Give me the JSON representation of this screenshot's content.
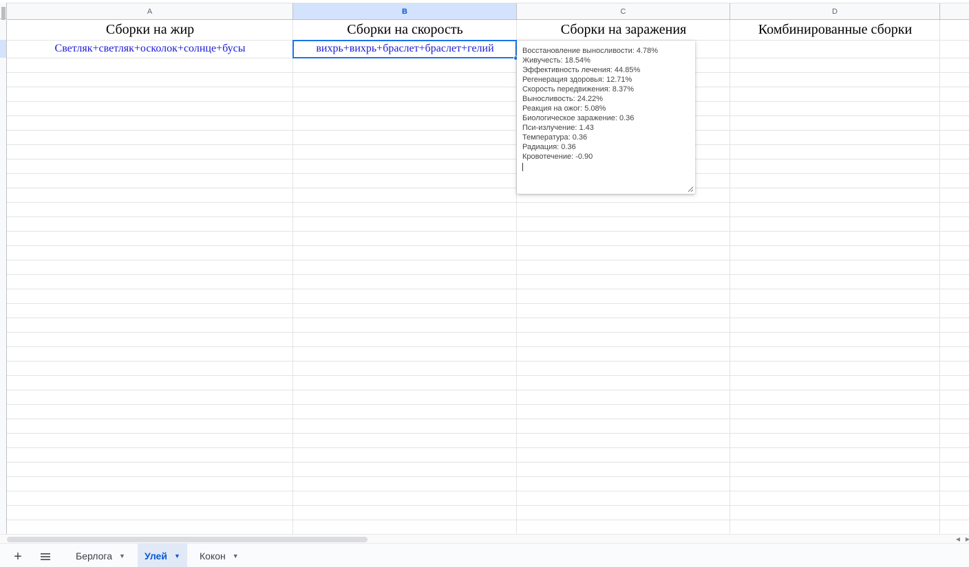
{
  "columns": [
    {
      "letter": "A",
      "selected": false
    },
    {
      "letter": "B",
      "selected": true
    },
    {
      "letter": "C",
      "selected": false
    },
    {
      "letter": "D",
      "selected": false
    }
  ],
  "row1": {
    "a": "Сборки на жир",
    "b": "Сборки на скорость",
    "c": "Сборки на заражения",
    "d": "Комбинированные сборки"
  },
  "row2": {
    "a": "Светляк+светляк+осколок+солнце+бусы",
    "b": "вихрь+вихрь+браслет+браслет+гелий"
  },
  "note": {
    "lines": [
      "Восстановление выносливости: 4.78%",
      "Живучесть: 18.54%",
      "Эффективность лечения: 44.85%",
      "Регенерация здоровья: 12.71%",
      "Скорость передвижения: 8.37%",
      "Выносливость: 24.22%",
      "Реакция на ожог: 5.08%",
      "Биологическое заражение: 0.36",
      "Пси-излучение: 1.43",
      "Температура: 0.36",
      "Радиация: 0.36",
      "Кровотечение: -0.90"
    ]
  },
  "sheets": [
    {
      "label": "Берлога",
      "active": false
    },
    {
      "label": "Улей",
      "active": true
    },
    {
      "label": "Кокон",
      "active": false
    }
  ],
  "toolbar": {
    "add_sheet": "+",
    "all_sheets": "≡"
  },
  "colors": {
    "accent": "#1a73e8",
    "cell_text": "#1a1ad6",
    "selected_header": "#d3e3fd"
  }
}
